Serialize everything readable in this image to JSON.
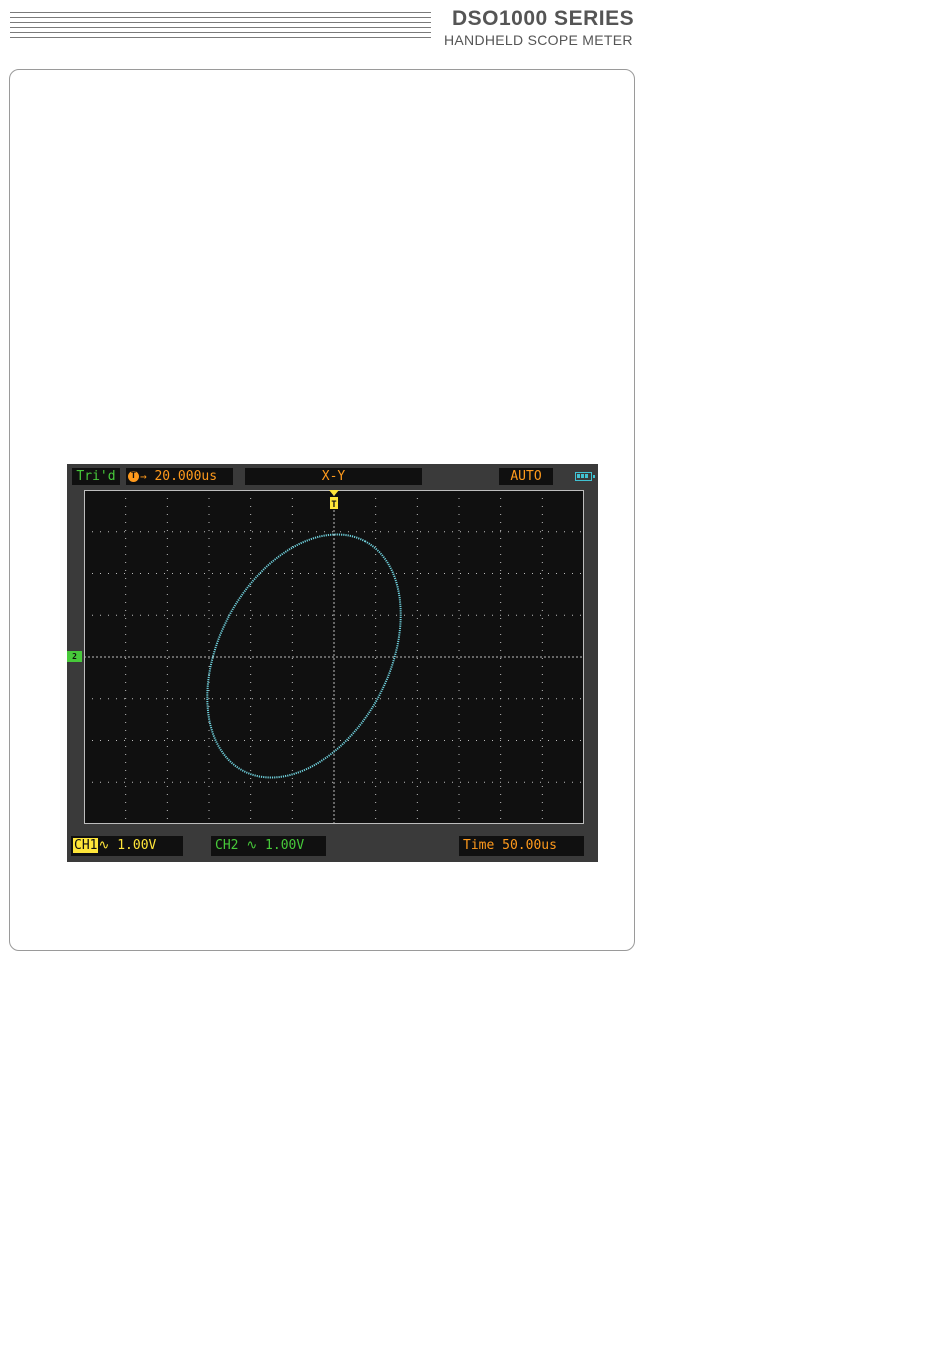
{
  "header": {
    "series_title": "DSO1000  SERIES",
    "subtitle": "HANDHELD SCOPE METER"
  },
  "scope": {
    "trigger_status": "Tri'd",
    "trigger_offset": "20.000us",
    "mode_label": "X-Y",
    "trigger_mode": "AUTO",
    "ch1_label": "CH1",
    "ch1_scale": "1.00V",
    "ch2_label": "CH2",
    "ch2_scale": "1.00V",
    "timebase_label": "Time 50.00us",
    "ch2_marker": "2",
    "trig_marker": "T",
    "coupling_symbol": "∿",
    "colors": {
      "screen_bg": "#101010",
      "bezel": "#3a3a3a",
      "trace": "#6fd0dc",
      "ch1": "#ffe63a",
      "ch2": "#47c93a",
      "orange": "#ff9a1c"
    },
    "battery_icon": "battery-icon"
  }
}
